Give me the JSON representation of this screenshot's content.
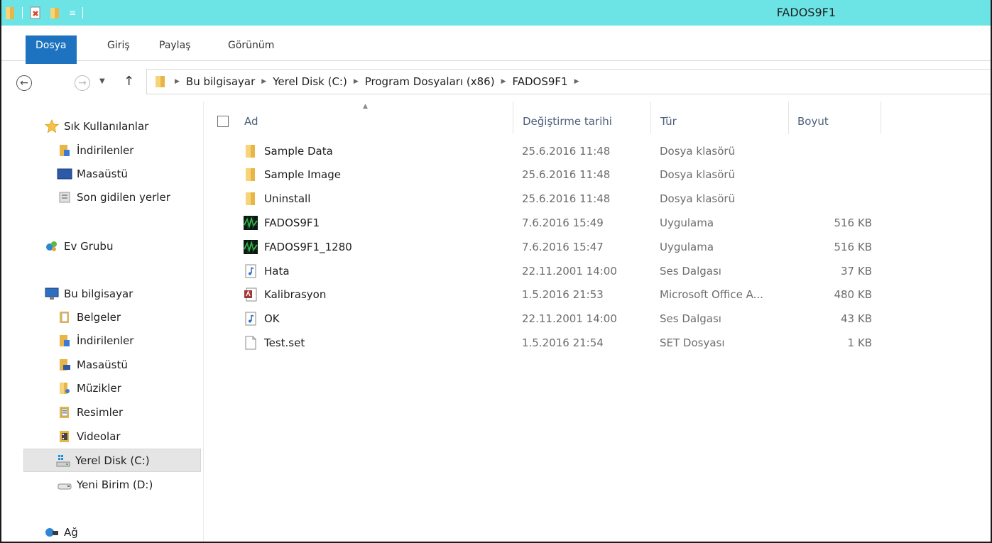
{
  "window": {
    "title": "FADOS9F1",
    "title_bar_color": "#6ce4e6"
  },
  "quick_access": {
    "icons": [
      "folder-icon",
      "properties-icon",
      "new-folder-icon",
      "customize-dropdown-icon"
    ]
  },
  "ribbon": {
    "tabs": [
      {
        "label": "Dosya",
        "active": true
      },
      {
        "label": "Giriş",
        "active": false
      },
      {
        "label": "Paylaş",
        "active": false
      },
      {
        "label": "Görünüm",
        "active": false
      }
    ],
    "active_color": "#1e73c0"
  },
  "address": {
    "crumbs": [
      "Bu bilgisayar",
      "Yerel Disk (C:)",
      "Program Dosyaları (x86)",
      "FADOS9F1"
    ]
  },
  "nav": {
    "favorites_header": "Sık Kullanılanlar",
    "favorites": [
      "İndirilenler",
      "Masaüstü",
      "Son gidilen yerler"
    ],
    "homegroup": "Ev Grubu",
    "this_pc_header": "Bu bilgisayar",
    "this_pc": [
      "Belgeler",
      "İndirilenler",
      "Masaüstü",
      "Müzikler",
      "Resimler",
      "Videolar",
      "Yerel Disk (C:)",
      "Yeni Birim (D:)"
    ],
    "selected": "Yerel Disk (C:)",
    "network": "Ağ"
  },
  "columns": {
    "name": "Ad",
    "date": "Değiştirme tarihi",
    "type": "Tür",
    "size": "Boyut"
  },
  "files": [
    {
      "name": "Sample Data",
      "date": "25.6.2016 11:48",
      "type": "Dosya klasörü",
      "size": "",
      "icon": "folder-icon"
    },
    {
      "name": "Sample Image",
      "date": "25.6.2016 11:48",
      "type": "Dosya klasörü",
      "size": "",
      "icon": "folder-icon"
    },
    {
      "name": "Uninstall",
      "date": "25.6.2016 11:48",
      "type": "Dosya klasörü",
      "size": "",
      "icon": "folder-icon"
    },
    {
      "name": "FADOS9F1",
      "date": "7.6.2016 15:49",
      "type": "Uygulama",
      "size": "516 KB",
      "icon": "application-icon"
    },
    {
      "name": "FADOS9F1_1280",
      "date": "7.6.2016 15:47",
      "type": "Uygulama",
      "size": "516 KB",
      "icon": "application-icon"
    },
    {
      "name": "Hata",
      "date": "22.11.2001 14:00",
      "type": "Ses Dalgası",
      "size": "37 KB",
      "icon": "audio-file-icon"
    },
    {
      "name": "Kalibrasyon",
      "date": "1.5.2016 21:53",
      "type": "Microsoft Office A...",
      "size": "480 KB",
      "icon": "access-database-icon"
    },
    {
      "name": "OK",
      "date": "22.11.2001 14:00",
      "type": "Ses Dalgası",
      "size": "43 KB",
      "icon": "audio-file-icon"
    },
    {
      "name": "Test.set",
      "date": "1.5.2016 21:54",
      "type": "SET Dosyası",
      "size": "1 KB",
      "icon": "blank-file-icon"
    }
  ]
}
